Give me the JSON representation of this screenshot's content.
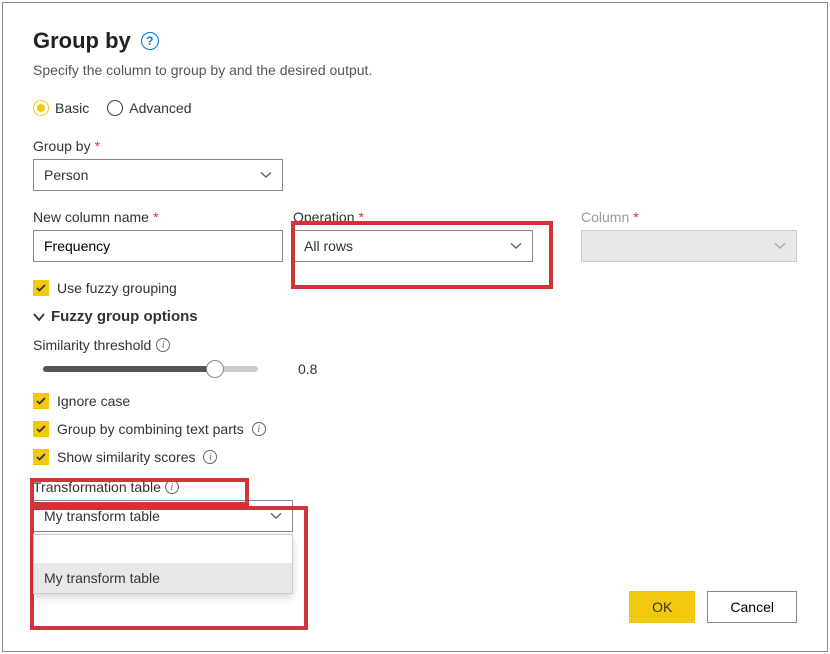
{
  "dialog": {
    "title": "Group by",
    "subtitle": "Specify the column to group by and the desired output."
  },
  "mode": {
    "basic": "Basic",
    "advanced": "Advanced"
  },
  "groupBy": {
    "label": "Group by",
    "value": "Person"
  },
  "newColumn": {
    "label": "New column name",
    "value": "Frequency"
  },
  "operation": {
    "label": "Operation",
    "value": "All rows"
  },
  "column": {
    "label": "Column"
  },
  "fuzzy": {
    "checkbox": "Use fuzzy grouping",
    "section": "Fuzzy group options",
    "threshold": "Similarity threshold",
    "thresholdValue": "0.8",
    "ignoreCase": "Ignore case",
    "combineText": "Group by combining text parts",
    "showScores": "Show similarity scores",
    "transformLabel": "Transformation table",
    "transformValue": "My transform table",
    "dropdownItem": "My transform table"
  },
  "buttons": {
    "ok": "OK",
    "cancel": "Cancel"
  }
}
